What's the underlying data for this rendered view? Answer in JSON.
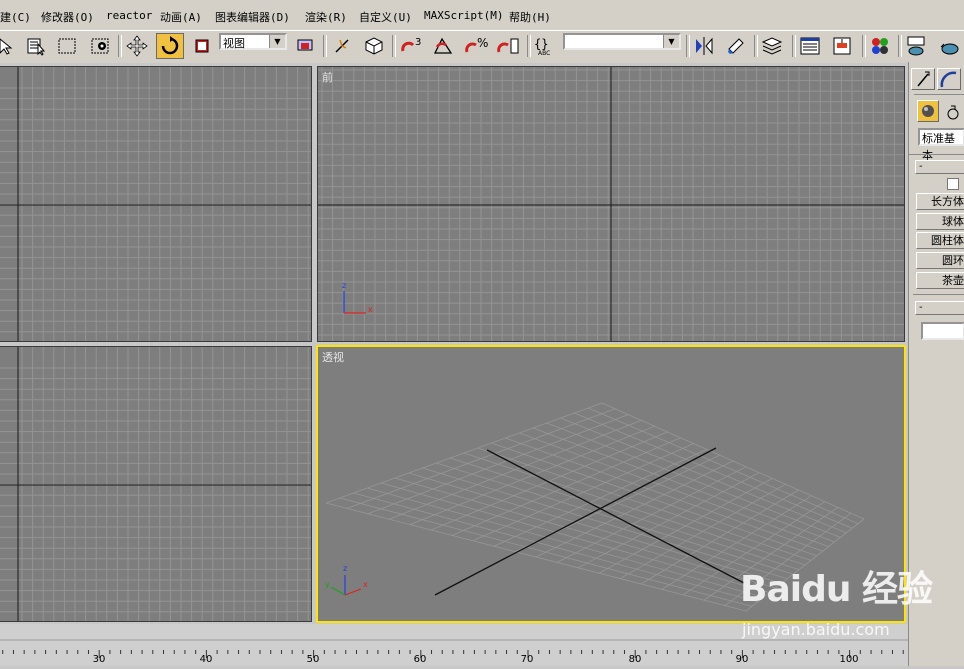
{
  "menu": [
    "建(C)",
    "修改器(O)",
    "reactor",
    "动画(A)",
    "图表编辑器(D)",
    "渲染(R)",
    "自定义(U)",
    "MAXScript(M)",
    "帮助(H)"
  ],
  "toolbar": {
    "view_dropdown": "视图",
    "snap_angle_label": "3",
    "percent_label": "%",
    "named_selection": ""
  },
  "viewports": {
    "top_left_label": "",
    "front_label": "前",
    "left_label": "",
    "perspective_label": "透视"
  },
  "axis": {
    "x": "x",
    "y": "y",
    "z": "z"
  },
  "command_panel": {
    "category_dropdown": "标准基本",
    "rollout_object_type": "-",
    "rollout_name": "-",
    "object_buttons": [
      "长方体",
      "球体",
      "圆柱体",
      "圆环",
      "茶壶"
    ]
  },
  "time_ruler": {
    "ticks": [
      "30",
      "40",
      "50",
      "60",
      "70",
      "80",
      "90",
      "100"
    ]
  },
  "watermark": {
    "logo": "Baidu 经验",
    "url": "jingyan.baidu.com"
  },
  "colors": {
    "active_viewport": "#ffe400",
    "viewport_bg": "#7e7e7e",
    "ui_bg": "#d4d0c8"
  }
}
